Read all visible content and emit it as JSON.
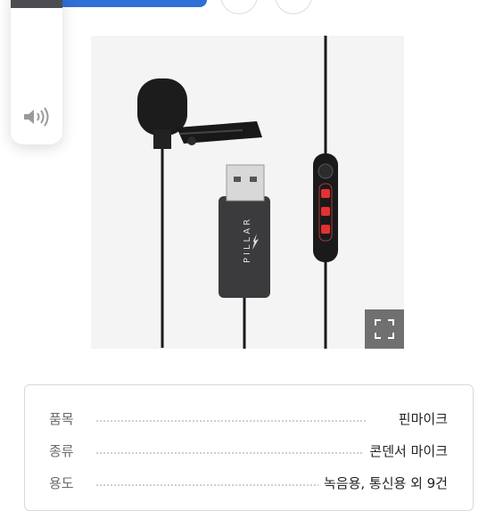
{
  "spec_table": {
    "rows": [
      {
        "label": "품목",
        "value": "핀마이크"
      },
      {
        "label": "종류",
        "value": "콘덴서 마이크"
      },
      {
        "label": "용도",
        "value": "녹음용, 통신용 외 9건"
      }
    ]
  },
  "product_image": {
    "brand_mark": "PILLAR"
  },
  "icons": {
    "volume": "speaker-icon",
    "expand": "expand-icon"
  },
  "colors": {
    "accent_blue": "#2f6fd8",
    "led_red": "#e53030"
  }
}
